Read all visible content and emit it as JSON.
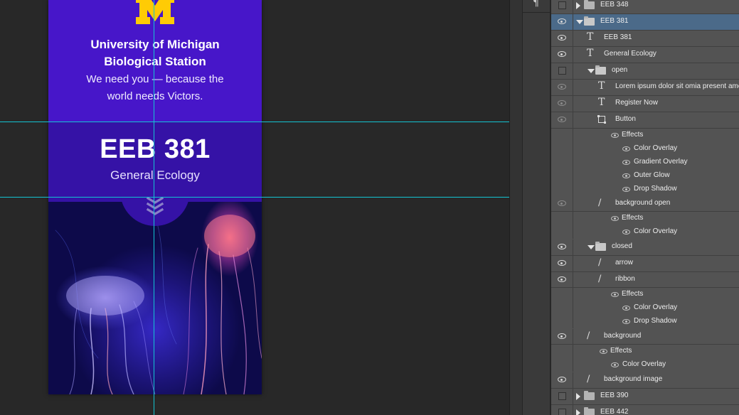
{
  "artboard": {
    "university_line1": "University of Michigan",
    "university_line2": "Biological Station",
    "tagline_line1": "We need you — because the",
    "tagline_line2": "world needs Victors.",
    "course_code": "EEB 381",
    "course_title": "General Ecology",
    "logo_letter": "M"
  },
  "colors": {
    "header_purple": "#4716c9",
    "ribbon_purple": "#3512a6",
    "maize": "#ffcb05",
    "guide_cyan": "#13c4d2",
    "selection_blue": "#4b6a89",
    "panel_gray": "#535353"
  },
  "tool_strip": {
    "icon": "paragraph-icon",
    "glyph": "¶"
  },
  "layers": [
    {
      "label": "EEB 348",
      "kind": "group",
      "expanded": false,
      "visible": false
    },
    {
      "label": "EEB 381",
      "kind": "group",
      "expanded": true,
      "visible": true,
      "selected": true
    },
    {
      "label": "EEB 381",
      "kind": "text",
      "visible": true
    },
    {
      "label": "General Ecology",
      "kind": "text",
      "visible": true
    },
    {
      "label": "open",
      "kind": "group",
      "expanded": true,
      "visible": false
    },
    {
      "label": "Lorem ipsum dolor sit omia present amet",
      "kind": "text",
      "visible": true
    },
    {
      "label": "Register Now",
      "kind": "text",
      "visible": true
    },
    {
      "label": "Button",
      "kind": "shape",
      "visible": true
    },
    {
      "label": "Effects",
      "kind": "effects-header"
    },
    {
      "label": "Color Overlay",
      "kind": "effect"
    },
    {
      "label": "Gradient Overlay",
      "kind": "effect"
    },
    {
      "label": "Outer Glow",
      "kind": "effect"
    },
    {
      "label": "Drop Shadow",
      "kind": "effect"
    },
    {
      "label": "background open",
      "kind": "brush",
      "visible": true
    },
    {
      "label": "Effects",
      "kind": "effects-header"
    },
    {
      "label": "Color Overlay",
      "kind": "effect"
    },
    {
      "label": "closed",
      "kind": "group",
      "expanded": true,
      "visible": true
    },
    {
      "label": "arrow",
      "kind": "brush",
      "visible": true
    },
    {
      "label": "ribbon",
      "kind": "brush",
      "visible": true
    },
    {
      "label": "Effects",
      "kind": "effects-header"
    },
    {
      "label": "Color Overlay",
      "kind": "effect"
    },
    {
      "label": "Drop Shadow",
      "kind": "effect"
    },
    {
      "label": "background",
      "kind": "brush",
      "visible": true
    },
    {
      "label": "Effects",
      "kind": "effects-header"
    },
    {
      "label": "Color Overlay",
      "kind": "effect"
    },
    {
      "label": "background image",
      "kind": "brush",
      "visible": true
    },
    {
      "label": "EEB 390",
      "kind": "group",
      "expanded": false,
      "visible": false
    },
    {
      "label": "EEB 442",
      "kind": "group",
      "expanded": false,
      "visible": false
    }
  ]
}
